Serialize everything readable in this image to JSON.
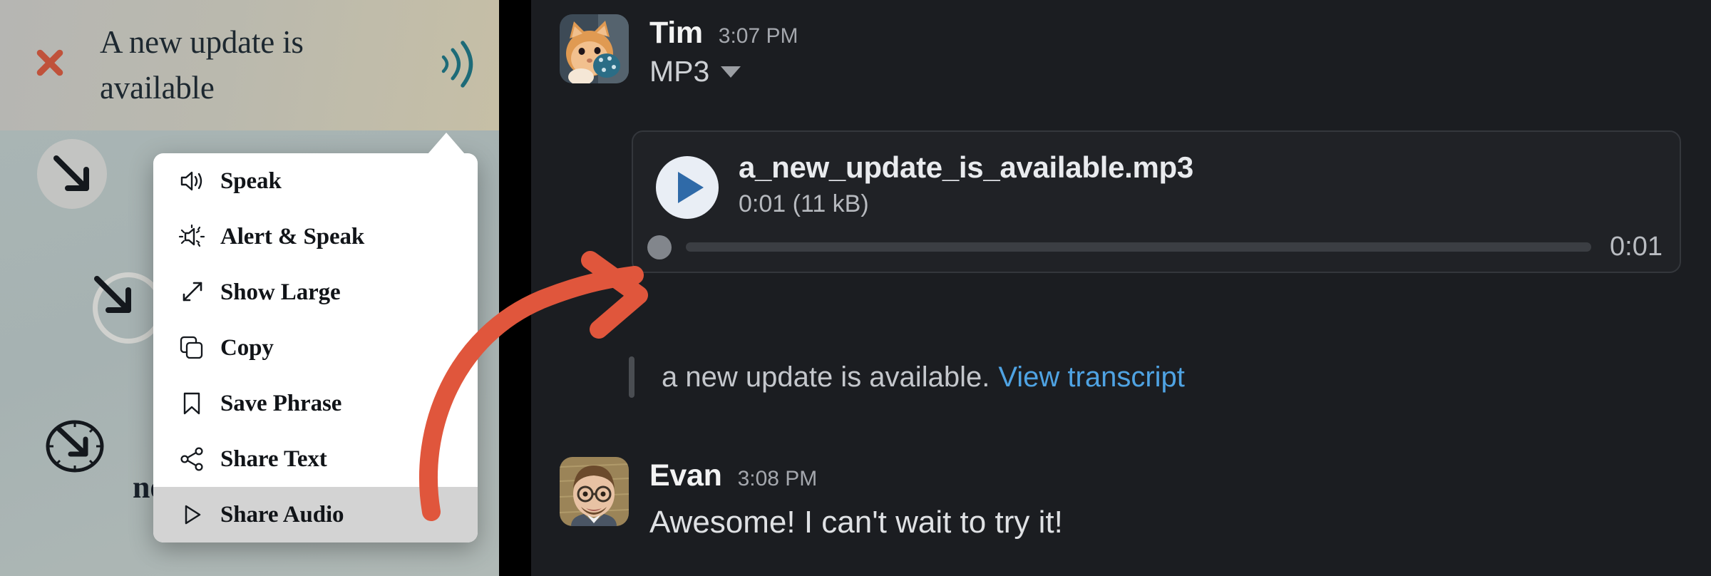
{
  "left_panel": {
    "close_button": {
      "name": "close",
      "icon": "close-x-icon",
      "color": "#c0523b"
    },
    "header": {
      "title": "A new update is available",
      "speaker_icon": "sound-wave-icon",
      "speaker_icon_color": "#1d6b78"
    },
    "background_word": "ne",
    "context_menu": {
      "items": [
        {
          "label": "Speak",
          "icon": "speaker-icon",
          "highlighted": false
        },
        {
          "label": "Alert & Speak",
          "icon": "alert-speaker-icon",
          "highlighted": false
        },
        {
          "label": "Show Large",
          "icon": "expand-arrows-icon",
          "highlighted": false
        },
        {
          "label": "Copy",
          "icon": "copy-icon",
          "highlighted": false
        },
        {
          "label": "Save Phrase",
          "icon": "bookmark-icon",
          "highlighted": false
        },
        {
          "label": "Share Text",
          "icon": "share-nodes-icon",
          "highlighted": false
        },
        {
          "label": "Share Audio",
          "icon": "play-triangle-icon",
          "highlighted": true
        }
      ]
    }
  },
  "chat_panel": {
    "messages": [
      {
        "author": "Tim",
        "time": "3:07 PM",
        "subtitle": "MP3",
        "subtitle_has_dropdown": true,
        "audio": {
          "filename": "a_new_update_is_available.mp3",
          "meta": "0:01 (11 kB)",
          "duration": "0:01",
          "progress_percent": 0,
          "play_icon": "play-triangle-icon"
        },
        "transcript": {
          "text": "a new update is available.",
          "link_label": "View transcript",
          "link_color": "#4fa3e3"
        }
      },
      {
        "author": "Evan",
        "time": "3:08 PM",
        "body": "Awesome! I can't wait to try it!"
      }
    ]
  },
  "annotation": {
    "arrow_color": "#e0563c",
    "description": "curved arrow from Share Audio menu item to audio message"
  }
}
